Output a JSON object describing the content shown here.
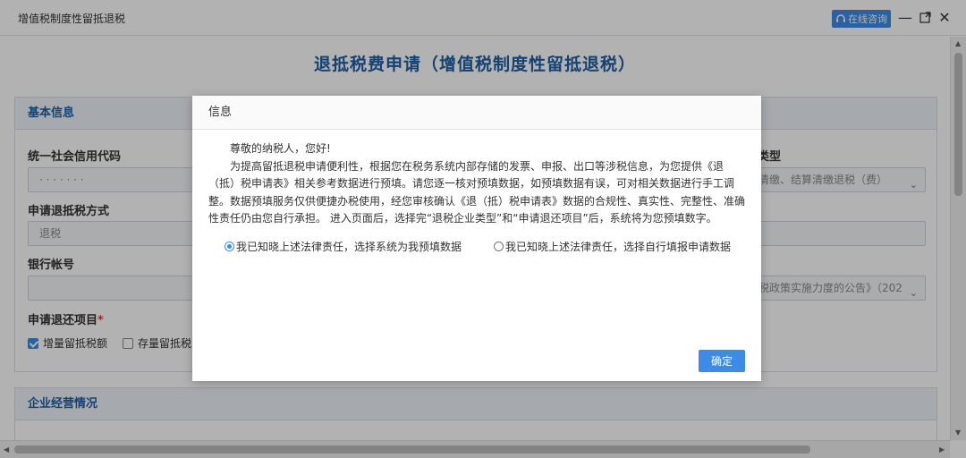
{
  "window": {
    "title": "增值税制度性留抵退税",
    "consult_label": "在线咨询"
  },
  "page": {
    "title": "退抵税费申请（增值税制度性留抵退税）",
    "basic_info": {
      "heading": "基本信息",
      "credit_code_label": "统一社会信用代码",
      "credit_code_value": "· · · · · · ·",
      "refund_method_label": "申请退抵税方式",
      "refund_method_value": "退税",
      "bank_account_label": "银行帐号",
      "refund_items_label": "申请退还项目",
      "required_mark": "*",
      "item_incremental": "增量留抵税额",
      "item_stock": "存量留抵税",
      "type_label": "类型",
      "type_value": "清缴、结算清缴退税（费）",
      "policy_value": "税政策实施力度的公告》（202"
    },
    "business": {
      "heading": "企业经营情况"
    }
  },
  "dialog": {
    "title": "信息",
    "greeting": "尊敬的纳税人，您好!",
    "body": "为提高留抵退税申请便利性，根据您在税务系统内部存储的发票、申报、出口等涉税信息，为您提供《退（抵）税申请表》相关参考数据进行预填。请您逐一核对预填数据，如预填数据有误，可对相关数据进行手工调整。数据预填服务仅供便捷办税使用，经您审核确认《退（抵）税申请表》数据的合规性、真实性、完整性、准确性责任仍由您自行承担。 进入页面后，选择完“退税企业类型”和“申请退还项目”后，系统将为您预填数字。",
    "option_prefill": "我已知晓上述法律责任，选择系统为我预填数据",
    "option_manual": "我已知晓上述法律责任，选择自行填报申请数据",
    "confirm_label": "确定"
  }
}
